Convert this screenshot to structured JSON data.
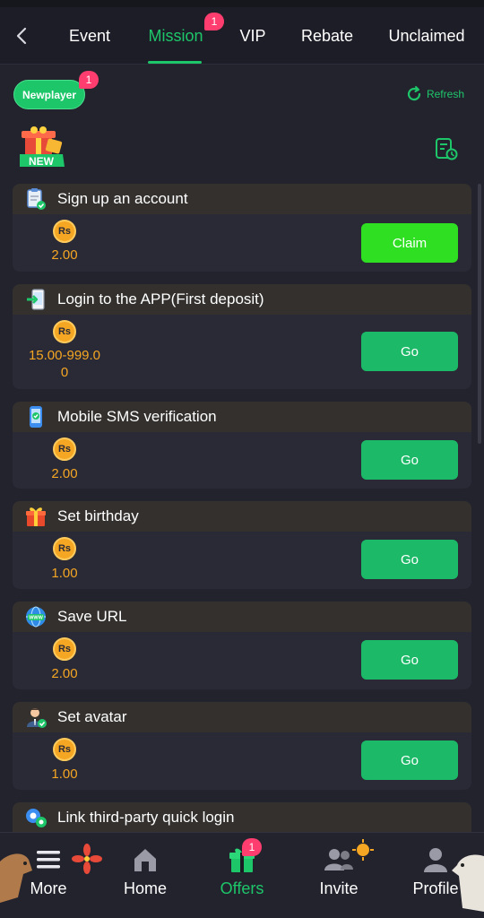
{
  "tabs": [
    {
      "label": "Event",
      "active": false
    },
    {
      "label": "Mission",
      "active": true,
      "badge": "1"
    },
    {
      "label": "VIP",
      "active": false
    },
    {
      "label": "Rebate",
      "active": false
    },
    {
      "label": "Unclaimed",
      "active": false
    }
  ],
  "subheader": {
    "newplayer_label": "Newplayer",
    "newplayer_badge": "1",
    "refresh_label": "Refresh",
    "new_icon_text": "NEW"
  },
  "currency_symbol": "Rs",
  "tasks": [
    {
      "title": "Sign up an account",
      "reward_line1": "2.00",
      "reward_line2": "",
      "action": "Claim",
      "icon": "clipboard-check-icon"
    },
    {
      "title": "Login to the APP(First deposit)",
      "reward_line1": "15.00-999.0",
      "reward_line2": "0",
      "action": "Go",
      "icon": "app-login-icon"
    },
    {
      "title": "Mobile SMS verification",
      "reward_line1": "2.00",
      "reward_line2": "",
      "action": "Go",
      "icon": "mobile-sms-icon"
    },
    {
      "title": "Set birthday",
      "reward_line1": "1.00",
      "reward_line2": "",
      "action": "Go",
      "icon": "gift-icon"
    },
    {
      "title": "Save URL",
      "reward_line1": "2.00",
      "reward_line2": "",
      "action": "Go",
      "icon": "www-globe-icon"
    },
    {
      "title": "Set avatar",
      "reward_line1": "1.00",
      "reward_line2": "",
      "action": "Go",
      "icon": "avatar-icon"
    },
    {
      "title": "Link third-party quick login",
      "reward_line1": "",
      "reward_line2": "",
      "action": "",
      "icon": "third-party-link-icon"
    }
  ],
  "bottom_nav": [
    {
      "label": "More",
      "icon": "menu-icon",
      "active": false
    },
    {
      "label": "Home",
      "icon": "home-icon",
      "active": false
    },
    {
      "label": "Offers",
      "icon": "gift-box-icon",
      "active": true,
      "badge": "1"
    },
    {
      "label": "Invite",
      "icon": "users-icon",
      "active": false
    },
    {
      "label": "Profile",
      "icon": "profile-icon",
      "active": false
    }
  ],
  "colors": {
    "accent": "#1ec66a",
    "claim": "#2fe022",
    "reward": "#f5a623",
    "badge": "#ff3d6e",
    "background": "#23232e"
  }
}
